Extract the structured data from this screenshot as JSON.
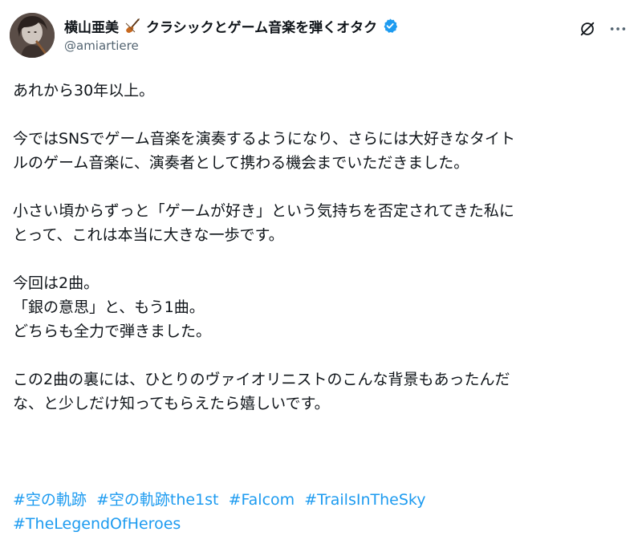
{
  "author": {
    "display_name": "横山亜美",
    "name_suffix": "クラシックとゲーム音楽を弾くオタク",
    "handle": "@amiartiere",
    "verified": true
  },
  "icons": {
    "name_emoji": "violin-icon",
    "verified": "verified-badge-icon",
    "grok": "grok-icon",
    "more": "more-icon"
  },
  "colors": {
    "link": "#1d9bf0",
    "text": "#0f1419",
    "secondary": "#536471"
  },
  "body": {
    "p1": [
      "あれから30年以上。"
    ],
    "p2": [
      "今ではSNSでゲーム音楽を演奏するようになり、さらには大好きなタイト",
      "ルのゲーム音楽に、演奏者として携わる機会までいただきました。"
    ],
    "p3": [
      "小さい頃からずっと「ゲームが好き」という気持ちを否定されてきた私に",
      "とって、これは本当に大きな一歩です。"
    ],
    "p4": [
      "今回は2曲。",
      "「銀の意思」と、もう1曲。",
      "どちらも全力で弾きました。"
    ],
    "p5": [
      "この2曲の裏には、ひとりのヴァイオリニストのこんな背景もあったんだ",
      "な、と少しだけ知ってもらえたら嬉しいです。"
    ]
  },
  "hashtags": [
    "#空の軌跡",
    "#空の軌跡the1st",
    "#Falcom",
    "#TrailsInTheSky",
    "#TheLegendOfHeroes"
  ]
}
